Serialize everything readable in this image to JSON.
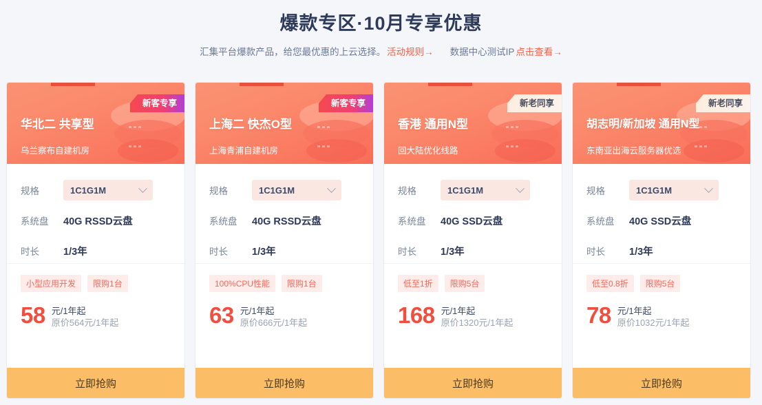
{
  "hero": {
    "title": "爆款专区·10月专享优惠",
    "subtitle": "汇集平台爆款产品，给您最优惠的上云选择。",
    "rule_link": "活动规则→",
    "test_ip_label": "数据中心测试IP",
    "test_ip_link": "点击查看→"
  },
  "labels": {
    "spec": "规格",
    "disk": "系统盘",
    "duration": "时长",
    "buy": "立即抢购"
  },
  "colors": {
    "accent_red": "#e8503a",
    "price_red": "#f04e3e",
    "buy_orange": "#fbbd66",
    "link_red": "#f4604a",
    "title_navy": "#2e3a59"
  },
  "cards": [
    {
      "title": "华北二 共享型",
      "desc": "乌兰察布自建机房",
      "badge": "新客专享",
      "badge_type": "new",
      "spec_value": "1C1G1M",
      "disk": "40G RSSD云盘",
      "duration": "1/3年",
      "tags": [
        "小型应用开发",
        "限购1台"
      ],
      "price": "58",
      "unit": "元/1年起",
      "original": "原价564元/1年起",
      "buy": "立即抢购"
    },
    {
      "title": "上海二 快杰O型",
      "desc": "上海青浦自建机房",
      "badge": "新客专享",
      "badge_type": "new",
      "spec_value": "1C1G1M",
      "disk": "40G RSSD云盘",
      "duration": "1/3年",
      "tags": [
        "100%CPU性能",
        "限购1台"
      ],
      "price": "63",
      "unit": "元/1年起",
      "original": "原价666元/1年起",
      "buy": "立即抢购"
    },
    {
      "title": "香港 通用N型",
      "desc": "回大陆优化线路",
      "badge": "新老同享",
      "badge_type": "share",
      "spec_value": "1C1G1M",
      "disk": "40G SSD云盘",
      "duration": "1/3年",
      "tags": [
        "低至1折",
        "限购5台"
      ],
      "price": "168",
      "unit": "元/1年起",
      "original": "原价1320元/1年起",
      "buy": "立即抢购"
    },
    {
      "title": "胡志明/新加坡 通用N型",
      "desc": "东南亚出海云服务器优选",
      "badge": "新老同享",
      "badge_type": "share",
      "spec_value": "1C1G1M",
      "disk": "40G SSD云盘",
      "duration": "1/3年",
      "tags": [
        "低至0.8折",
        "限购5台"
      ],
      "price": "78",
      "unit": "元/1年起",
      "original": "原价1032元/1年起",
      "buy": "立即抢购"
    }
  ]
}
